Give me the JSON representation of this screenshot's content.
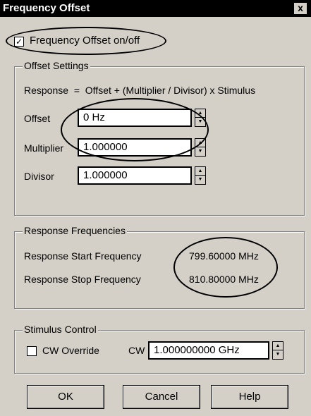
{
  "window": {
    "title": "Frequency Offset",
    "close_label": "x"
  },
  "toggle": {
    "label": "Frequency Offset on/off",
    "checked_mark": "✓"
  },
  "offset_settings": {
    "legend": "Offset Settings",
    "formula": "Response  =  Offset + (Multiplier / Divisor) x Stimulus",
    "offset_label": "Offset",
    "offset_value": "0 Hz",
    "multiplier_label": "Multiplier",
    "multiplier_value": "1.000000",
    "divisor_label": "Divisor",
    "divisor_value": "1.000000"
  },
  "response_frequencies": {
    "legend": "Response Frequencies",
    "start_label": "Response Start Frequency",
    "start_value": "799.60000 MHz",
    "stop_label": "Response Stop Frequency",
    "stop_value": "810.80000 MHz"
  },
  "stimulus_control": {
    "legend": "Stimulus Control",
    "cw_override_label": "CW Override",
    "cw_label": "CW",
    "cw_value": "1.000000000 GHz"
  },
  "buttons": {
    "ok": "OK",
    "cancel": "Cancel",
    "help": "Help"
  },
  "spin_glyphs": {
    "up": "▲",
    "down": "▼"
  }
}
